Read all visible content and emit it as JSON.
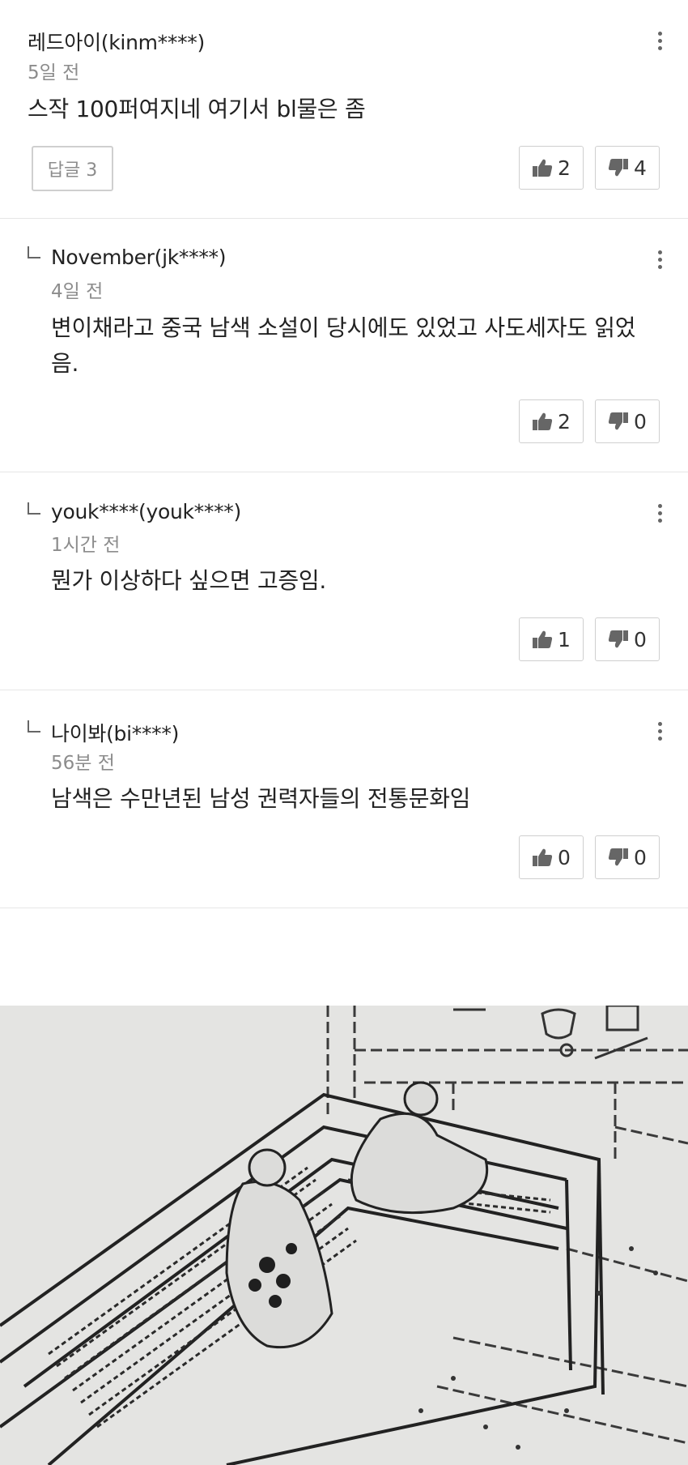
{
  "comments": [
    {
      "author": "레드아이(kinm****)",
      "time": "5일 전",
      "text": "스작 100퍼여지네 여기서 bl물은 좀",
      "reply_button": "답글 3",
      "likes": "2",
      "dislikes": "4"
    },
    {
      "author": "November(jk****)",
      "time": "4일 전",
      "text": "변이채라고 중국 남색 소설이 당시에도 있었고 사도세자도 읽었음.",
      "likes": "2",
      "dislikes": "0"
    },
    {
      "author": "youk****(youk****)",
      "time": "1시간 전",
      "text": "뭔가 이상하다 싶으면 고증임.",
      "likes": "1",
      "dislikes": "0"
    },
    {
      "author": "나이봐(bi****)",
      "time": "56분 전",
      "text": "남색은 수만년된 남성 권력자들의 전통문화임",
      "likes": "0",
      "dislikes": "0"
    }
  ],
  "icons": {
    "like": "thumbs-up-icon",
    "dislike": "thumbs-down-icon",
    "more": "more-vertical-icon",
    "reply": "reply-indent-icon"
  },
  "colors": {
    "text": "#222222",
    "meta": "#8c8c8c",
    "border": "#cfcfcf",
    "icon": "#666666"
  }
}
